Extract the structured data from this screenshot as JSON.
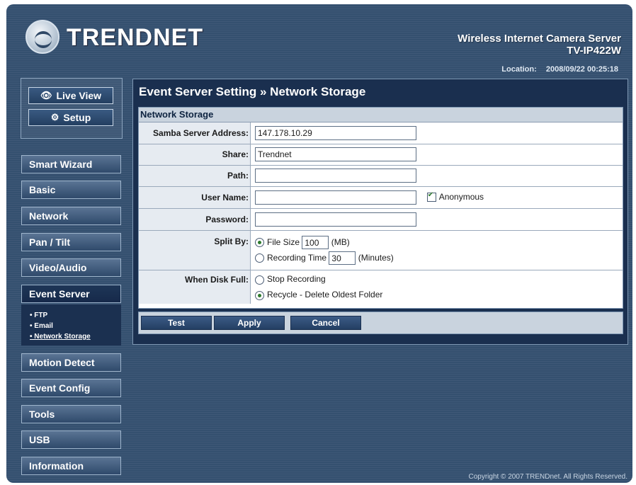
{
  "brand": {
    "logo_text": "TRENDNET",
    "product_line": "Wireless Internet Camera Server",
    "model": "TV-IP422W"
  },
  "location": {
    "label": "Location:",
    "datetime": "2008/09/22 00:25:18"
  },
  "top_nav": {
    "live_view": "Live View",
    "setup": "Setup"
  },
  "menu": [
    {
      "label": "Smart Wizard"
    },
    {
      "label": "Basic"
    },
    {
      "label": "Network"
    },
    {
      "label": "Pan / Tilt"
    },
    {
      "label": "Video/Audio"
    },
    {
      "label": "Event Server"
    },
    {
      "label": "Motion Detect"
    },
    {
      "label": "Event Config"
    },
    {
      "label": "Tools"
    },
    {
      "label": "USB"
    },
    {
      "label": "Information"
    }
  ],
  "submenu": [
    "• FTP",
    "• Email",
    "• Network Storage"
  ],
  "page": {
    "title": "Event Server Setting » Network Storage",
    "section": "Network Storage"
  },
  "form": {
    "samba_label": "Samba Server Address:",
    "samba_value": "147.178.10.29",
    "share_label": "Share:",
    "share_value": "Trendnet",
    "path_label": "Path:",
    "path_value": "",
    "user_label": "User Name:",
    "user_value": "",
    "anonymous_label": "Anonymous",
    "password_label": "Password:",
    "password_value": "",
    "split_label": "Split By:",
    "file_size_label": "File Size",
    "file_size_value": "100",
    "file_size_unit": "(MB)",
    "rec_time_label": "Recording Time",
    "rec_time_value": "30",
    "rec_time_unit": "(Minutes)",
    "disk_full_label": "When Disk Full:",
    "stop_label": "Stop Recording",
    "recycle_label": "Recycle - Delete Oldest Folder"
  },
  "buttons": {
    "test": "Test",
    "apply": "Apply",
    "cancel": "Cancel"
  },
  "footer": {
    "copyright": "Copyright © 2007 TRENDnet. All Rights Reserved."
  }
}
